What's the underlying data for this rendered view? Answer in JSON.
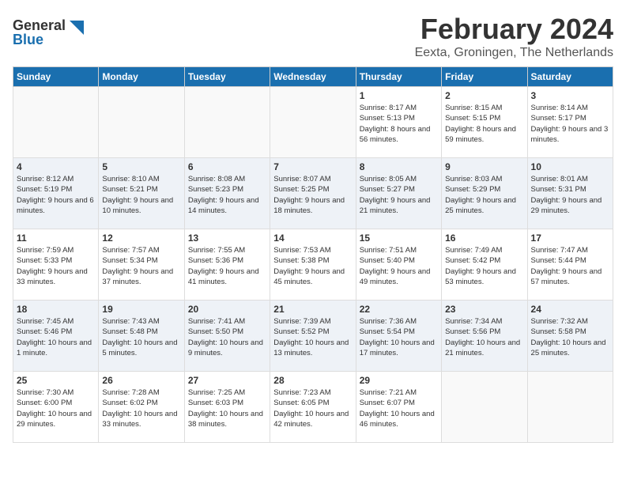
{
  "header": {
    "logo_line1": "General",
    "logo_line2": "Blue",
    "month": "February 2024",
    "location": "Eexta, Groningen, The Netherlands"
  },
  "weekdays": [
    "Sunday",
    "Monday",
    "Tuesday",
    "Wednesday",
    "Thursday",
    "Friday",
    "Saturday"
  ],
  "rows": [
    {
      "cells": [
        {
          "empty": true
        },
        {
          "empty": true
        },
        {
          "empty": true
        },
        {
          "empty": true
        },
        {
          "day": 1,
          "sunrise": "8:17 AM",
          "sunset": "5:13 PM",
          "daylight": "8 hours and 56 minutes."
        },
        {
          "day": 2,
          "sunrise": "8:15 AM",
          "sunset": "5:15 PM",
          "daylight": "8 hours and 59 minutes."
        },
        {
          "day": 3,
          "sunrise": "8:14 AM",
          "sunset": "5:17 PM",
          "daylight": "9 hours and 3 minutes."
        }
      ]
    },
    {
      "alt": true,
      "cells": [
        {
          "day": 4,
          "sunrise": "8:12 AM",
          "sunset": "5:19 PM",
          "daylight": "9 hours and 6 minutes."
        },
        {
          "day": 5,
          "sunrise": "8:10 AM",
          "sunset": "5:21 PM",
          "daylight": "9 hours and 10 minutes."
        },
        {
          "day": 6,
          "sunrise": "8:08 AM",
          "sunset": "5:23 PM",
          "daylight": "9 hours and 14 minutes."
        },
        {
          "day": 7,
          "sunrise": "8:07 AM",
          "sunset": "5:25 PM",
          "daylight": "9 hours and 18 minutes."
        },
        {
          "day": 8,
          "sunrise": "8:05 AM",
          "sunset": "5:27 PM",
          "daylight": "9 hours and 21 minutes."
        },
        {
          "day": 9,
          "sunrise": "8:03 AM",
          "sunset": "5:29 PM",
          "daylight": "9 hours and 25 minutes."
        },
        {
          "day": 10,
          "sunrise": "8:01 AM",
          "sunset": "5:31 PM",
          "daylight": "9 hours and 29 minutes."
        }
      ]
    },
    {
      "cells": [
        {
          "day": 11,
          "sunrise": "7:59 AM",
          "sunset": "5:33 PM",
          "daylight": "9 hours and 33 minutes."
        },
        {
          "day": 12,
          "sunrise": "7:57 AM",
          "sunset": "5:34 PM",
          "daylight": "9 hours and 37 minutes."
        },
        {
          "day": 13,
          "sunrise": "7:55 AM",
          "sunset": "5:36 PM",
          "daylight": "9 hours and 41 minutes."
        },
        {
          "day": 14,
          "sunrise": "7:53 AM",
          "sunset": "5:38 PM",
          "daylight": "9 hours and 45 minutes."
        },
        {
          "day": 15,
          "sunrise": "7:51 AM",
          "sunset": "5:40 PM",
          "daylight": "9 hours and 49 minutes."
        },
        {
          "day": 16,
          "sunrise": "7:49 AM",
          "sunset": "5:42 PM",
          "daylight": "9 hours and 53 minutes."
        },
        {
          "day": 17,
          "sunrise": "7:47 AM",
          "sunset": "5:44 PM",
          "daylight": "9 hours and 57 minutes."
        }
      ]
    },
    {
      "alt": true,
      "cells": [
        {
          "day": 18,
          "sunrise": "7:45 AM",
          "sunset": "5:46 PM",
          "daylight": "10 hours and 1 minute."
        },
        {
          "day": 19,
          "sunrise": "7:43 AM",
          "sunset": "5:48 PM",
          "daylight": "10 hours and 5 minutes."
        },
        {
          "day": 20,
          "sunrise": "7:41 AM",
          "sunset": "5:50 PM",
          "daylight": "10 hours and 9 minutes."
        },
        {
          "day": 21,
          "sunrise": "7:39 AM",
          "sunset": "5:52 PM",
          "daylight": "10 hours and 13 minutes."
        },
        {
          "day": 22,
          "sunrise": "7:36 AM",
          "sunset": "5:54 PM",
          "daylight": "10 hours and 17 minutes."
        },
        {
          "day": 23,
          "sunrise": "7:34 AM",
          "sunset": "5:56 PM",
          "daylight": "10 hours and 21 minutes."
        },
        {
          "day": 24,
          "sunrise": "7:32 AM",
          "sunset": "5:58 PM",
          "daylight": "10 hours and 25 minutes."
        }
      ]
    },
    {
      "cells": [
        {
          "day": 25,
          "sunrise": "7:30 AM",
          "sunset": "6:00 PM",
          "daylight": "10 hours and 29 minutes."
        },
        {
          "day": 26,
          "sunrise": "7:28 AM",
          "sunset": "6:02 PM",
          "daylight": "10 hours and 33 minutes."
        },
        {
          "day": 27,
          "sunrise": "7:25 AM",
          "sunset": "6:03 PM",
          "daylight": "10 hours and 38 minutes."
        },
        {
          "day": 28,
          "sunrise": "7:23 AM",
          "sunset": "6:05 PM",
          "daylight": "10 hours and 42 minutes."
        },
        {
          "day": 29,
          "sunrise": "7:21 AM",
          "sunset": "6:07 PM",
          "daylight": "10 hours and 46 minutes."
        },
        {
          "empty": true
        },
        {
          "empty": true
        }
      ]
    }
  ]
}
